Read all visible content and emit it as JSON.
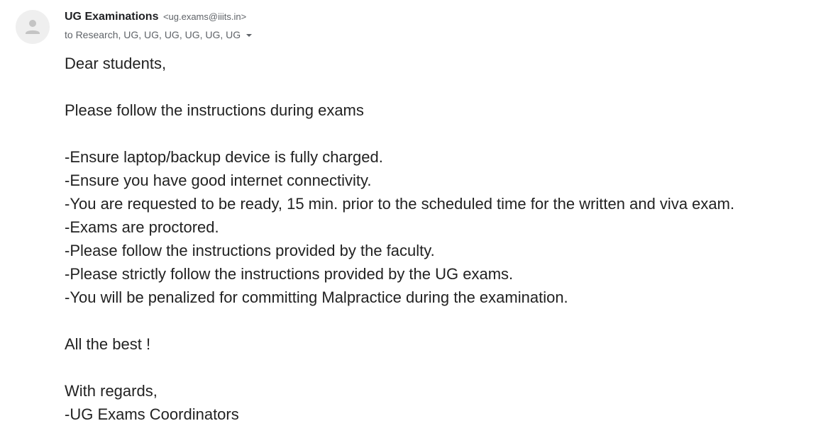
{
  "email": {
    "sender_name": "UG Examinations",
    "sender_email": "<ug.exams@iiits.in>",
    "recipients": "to Research, UG, UG, UG, UG, UG, UG",
    "avatar_icon": "person-icon",
    "body": {
      "greeting": "Dear students,",
      "intro": "Please follow the instructions during exams",
      "instructions": [
        "-Ensure laptop/backup device is fully charged.",
        "-Ensure you have good internet connectivity.",
        "-You are requested to be ready, 15 min. prior to the scheduled time for the written and viva exam.",
        "-Exams are proctored.",
        "-Please follow the instructions provided by the faculty.",
        "-Please strictly follow the instructions provided by the UG exams.",
        "-You will be penalized for committing Malpractice during the examination."
      ],
      "wish": "All the best !",
      "closing": "With regards,",
      "signature": "-UG Exams Coordinators"
    }
  }
}
